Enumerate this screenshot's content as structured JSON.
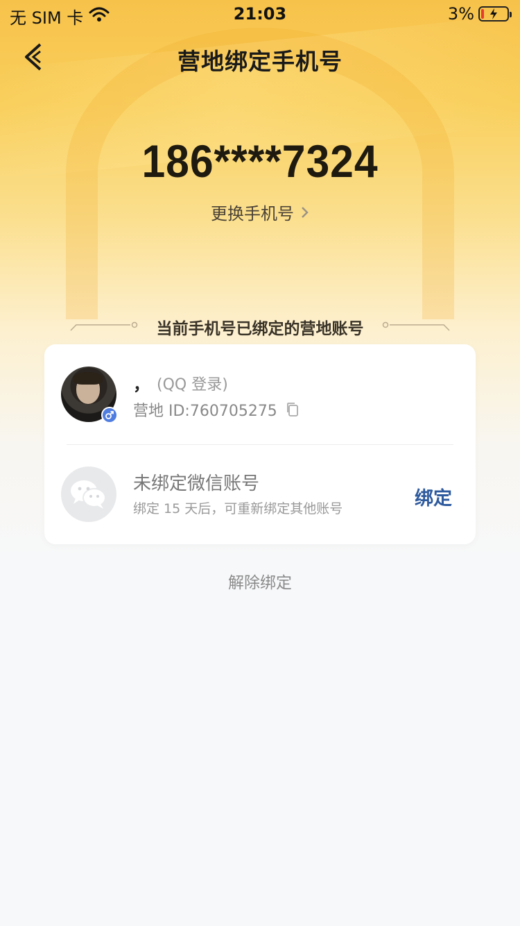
{
  "status_bar": {
    "carrier": "无 SIM 卡",
    "time": "21:03",
    "battery": "3%"
  },
  "header": {
    "title": "营地绑定手机号",
    "back_icon": "chevron-left-icon"
  },
  "phone": {
    "number": "186****7324",
    "change_label": "更换手机号"
  },
  "section": {
    "label": "当前手机号已绑定的营地账号"
  },
  "account": {
    "name": "，",
    "login_type": "(QQ 登录)",
    "camp_id": "营地 ID:760705275",
    "gender_icon": "male-icon"
  },
  "wechat": {
    "title": "未绑定微信账号",
    "note": "绑定 15 天后，可重新绑定其他账号",
    "bind_label": "绑定"
  },
  "footer": {
    "unbind_label": "解除绑定"
  },
  "colors": {
    "accent": "#2e5a9e",
    "header_gold": "#f7c24a",
    "gender_badge": "#4f7de0"
  }
}
